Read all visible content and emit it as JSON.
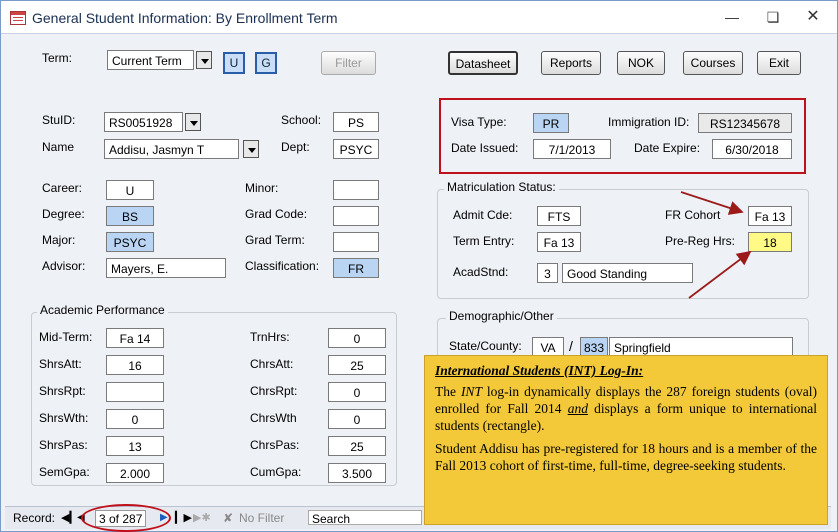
{
  "window": {
    "title": "General Student Information:  By Enrollment Term"
  },
  "top": {
    "term_label": "Term:",
    "term_value": "Current Term",
    "u": "U",
    "g": "G",
    "filter": "Filter"
  },
  "actions": {
    "datasheet": "Datasheet",
    "reports": "Reports",
    "nok": "NOK",
    "courses": "Courses",
    "exit": "Exit"
  },
  "student": {
    "stuid_label": "StuID:",
    "stuid": "RS0051928",
    "name_label": "Name",
    "name": "Addisu, Jasmyn T",
    "school_label": "School:",
    "school": "PS",
    "dept_label": "Dept:",
    "dept": "PSYC"
  },
  "visa": {
    "type_label": "Visa Type:",
    "type": "PR",
    "imm_label": "Immigration ID:",
    "imm": "RS12345678",
    "issued_label": "Date Issued:",
    "issued": "7/1/2013",
    "expire_label": "Date Expire:",
    "expire": "6/30/2018"
  },
  "program": {
    "career_label": "Career:",
    "career": "U",
    "degree_label": "Degree:",
    "degree": "BS",
    "major_label": "Major:",
    "major": "PSYC",
    "advisor_label": "Advisor:",
    "advisor": "Mayers, E.",
    "minor_label": "Minor:",
    "minor": "",
    "gradcode_label": "Grad Code:",
    "gradcode": "",
    "gradterm_label": "Grad Term:",
    "gradterm": "",
    "class_label": "Classification:",
    "class": "FR"
  },
  "matric": {
    "title": "Matriculation Status:",
    "admit_label": "Admit Cde:",
    "admit": "FTS",
    "fr_label": "FR Cohort",
    "fr": "Fa 13",
    "term_label": "Term Entry:",
    "term": "Fa 13",
    "prereg_label": "Pre-Reg Hrs:",
    "prereg": "18",
    "acad_label": "AcadStnd:",
    "acad_code": "3",
    "acad_text": "Good Standing"
  },
  "perf": {
    "title": "Academic Performance",
    "midterm_label": "Mid-Term:",
    "midterm": "Fa 14",
    "shrsatt_label": "ShrsAtt:",
    "shrsatt": "16",
    "shrsrpt_label": "ShrsRpt:",
    "shrsrpt": "",
    "shrswth_label": "ShrsWth:",
    "shrswth": "0",
    "shrspas_label": "ShrsPas:",
    "shrspas": "13",
    "semgpa_label": "SemGpa:",
    "semgpa": "2.000",
    "trnhrs_label": "TrnHrs:",
    "trnhrs": "0",
    "chrsatt_label": "ChrsAtt:",
    "chrsatt": "25",
    "chrsrpt_label": "ChrsRpt:",
    "chrsrpt": "0",
    "chrswth_label": "ChrsWth",
    "chrswth": "0",
    "chrspas_label": "ChrsPas:",
    "chrspas": "25",
    "cumgpa_label": "CumGpa:",
    "cumgpa": "3.500"
  },
  "demo": {
    "title": "Demographic/Other",
    "state_label": "State/County:",
    "state": "VA",
    "sep": "/",
    "county_code": "833",
    "county": "Springfield"
  },
  "note": {
    "heading": "International Students (INT) Log-In:",
    "p1_a": "The ",
    "p1_int": "INT",
    "p1_b": " log-in dynamically displays the 287 foreign students (oval) enrolled for Fall 2014 ",
    "p1_and": "and",
    "p1_c": " displays a form unique to international students (rectangle).",
    "p2": "Student Addisu has pre-registered for 18 hours and is a member of the Fall 2013 cohort of first-time, full-time, degree-seeking students."
  },
  "record": {
    "label": "Record:",
    "position": "3 of 287",
    "nofilter": "No Filter",
    "search": "Search"
  },
  "colors": {
    "highlight_blue": "#b9d5f3",
    "highlight_yellow": "#fffa86",
    "annotation_red": "#c0101c",
    "note_bg": "#f3c93a"
  }
}
